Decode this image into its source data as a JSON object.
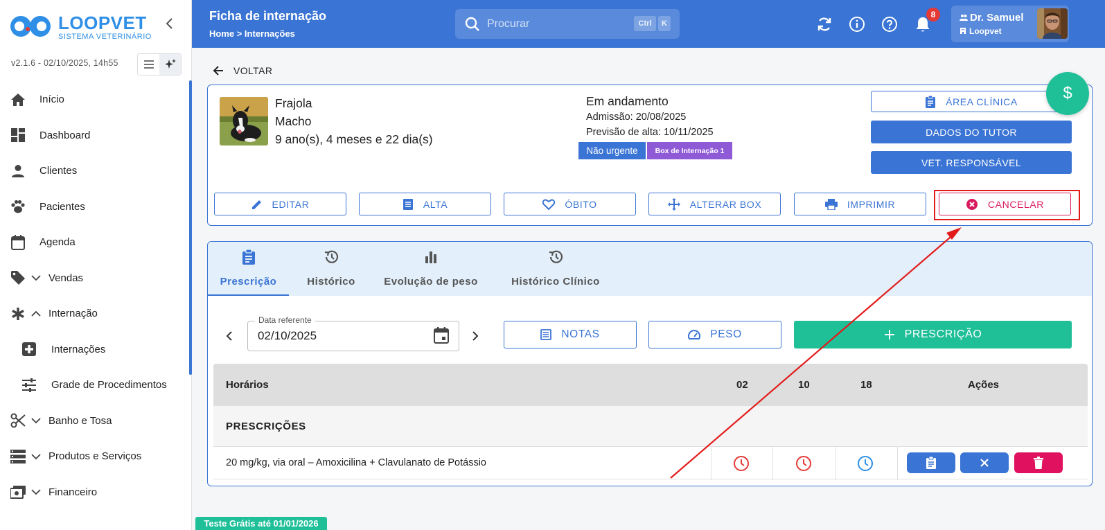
{
  "brand": {
    "name": "LOOPVET",
    "subtitle": "SISTEMA VETERINÁRIO"
  },
  "version": "v2.1.6 - 02/10/2025, 14h55",
  "sidebar": {
    "items": [
      {
        "label": "Início",
        "icon": "home-icon"
      },
      {
        "label": "Dashboard",
        "icon": "dashboard-icon"
      },
      {
        "label": "Clientes",
        "icon": "person-icon"
      },
      {
        "label": "Pacientes",
        "icon": "paw-icon"
      },
      {
        "label": "Agenda",
        "icon": "calendar-icon"
      },
      {
        "label": "Vendas",
        "icon": "tag-icon"
      },
      {
        "label": "Internação",
        "icon": "asterisk-icon"
      },
      {
        "label": "Internações",
        "icon": "medical-box-icon"
      },
      {
        "label": "Grade de Procedimentos",
        "icon": "sliders-icon"
      },
      {
        "label": "Banho e Tosa",
        "icon": "scissors-icon"
      },
      {
        "label": "Produtos e Serviços",
        "icon": "list-icon"
      },
      {
        "label": "Financeiro",
        "icon": "money-icon"
      }
    ]
  },
  "header": {
    "title": "Ficha de internação",
    "breadcrumb": "Home  >  Internações",
    "search_placeholder": "Procurar",
    "kbd_ctrl": "Ctrl",
    "kbd_k": "K",
    "notifications": "8",
    "user_name": "Dr. Samuel",
    "user_org": "Loopvet"
  },
  "back_label": "VOLTAR",
  "patient": {
    "name": "Frajola",
    "sex": "Macho",
    "age": "9 ano(s), 4 meses e 22 dia(s)",
    "status": "Em andamento",
    "admission": "Admissão: 20/08/2025",
    "discharge_forecast": "Previsão de alta: 10/11/2025",
    "tag_priority": "Não urgente",
    "tag_box": "Box de Internação 1"
  },
  "buttons": {
    "area_clinica": "ÁREA CLÍNICA",
    "dados_tutor": "DADOS DO TUTOR",
    "vet_responsavel": "VET. RESPONSÁVEL",
    "editar": "EDITAR",
    "alta": "ALTA",
    "obito": "ÓBITO",
    "alterar_box": "ALTERAR BOX",
    "imprimir": "IMPRIMIR",
    "cancelar": "CANCELAR",
    "fab": "$"
  },
  "tabs": [
    "Prescrição",
    "Histórico",
    "Evolução de peso",
    "Histórico Clínico"
  ],
  "date_field": {
    "label": "Data referente",
    "value": "02/10/2025"
  },
  "toolbar": {
    "notas": "NOTAS",
    "peso": "PESO",
    "prescricao": "PRESCRIÇÃO"
  },
  "table": {
    "headers": [
      "Horários",
      "02",
      "10",
      "18",
      "Ações"
    ],
    "section": "PRESCRIÇÕES",
    "rows": [
      {
        "description": "20 mg/kg, via oral – Amoxicilina + Clavulanato de Potássio"
      }
    ]
  },
  "trial_banner": "Teste Grátis até 01/01/2026",
  "colors": {
    "primary": "#3a74d4",
    "accent": "#1fbf98",
    "danger": "#d81b60",
    "annotation": "#e21b1b"
  }
}
